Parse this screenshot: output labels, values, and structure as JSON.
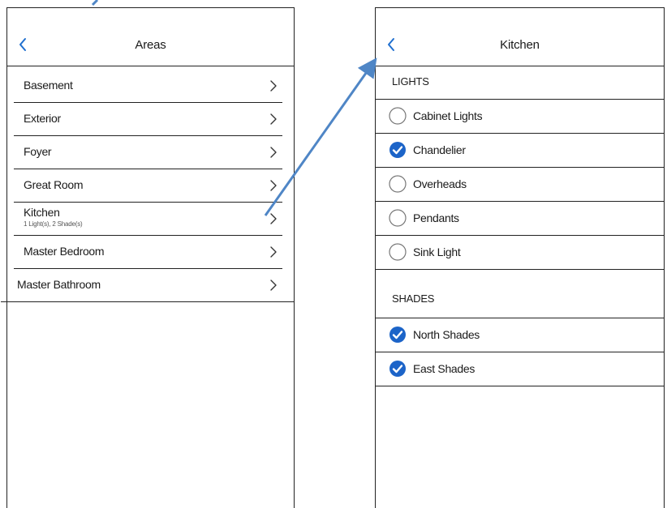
{
  "colors": {
    "accent": "#1f6fcf",
    "check_fill": "#1c64c8",
    "arrow": "#4f86c6",
    "line": "#222222"
  },
  "areas_screen": {
    "title": "Areas",
    "back_icon": "chevron-left-icon",
    "items": [
      {
        "name": "Basement",
        "subtitle": ""
      },
      {
        "name": "Exterior",
        "subtitle": ""
      },
      {
        "name": "Foyer",
        "subtitle": ""
      },
      {
        "name": "Great Room",
        "subtitle": ""
      },
      {
        "name": "Kitchen",
        "subtitle": "1 Light(s), 2 Shade(s)"
      },
      {
        "name": "Master Bedroom",
        "subtitle": ""
      },
      {
        "name": "Master Bathroom",
        "subtitle": ""
      }
    ]
  },
  "kitchen_screen": {
    "title": "Kitchen",
    "back_icon": "chevron-left-icon",
    "lights_header": "LIGHTS",
    "lights": [
      {
        "name": "Cabinet Lights",
        "selected": false
      },
      {
        "name": "Chandelier",
        "selected": true
      },
      {
        "name": "Overheads",
        "selected": false
      },
      {
        "name": "Pendants",
        "selected": false
      },
      {
        "name": "Sink Light",
        "selected": false
      }
    ],
    "shades_header": "SHADES",
    "shades": [
      {
        "name": "North Shades",
        "selected": true
      },
      {
        "name": "East Shades",
        "selected": true
      }
    ]
  }
}
